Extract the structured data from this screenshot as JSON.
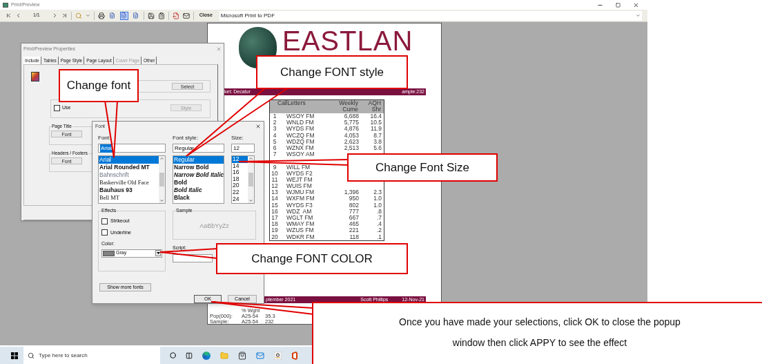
{
  "window": {
    "title": "Print/Preview"
  },
  "toolbar": {
    "page": "1/1",
    "view_modes": [
      {
        "selected": false
      },
      {
        "selected": true
      },
      {
        "selected": false
      }
    ],
    "close": "Close",
    "printer": "Microsoft Print to PDF"
  },
  "report": {
    "logo_text": "EASTLAN",
    "header_left": "ket: Decatur",
    "header_right": "ample:232",
    "columns": [
      "CallLetters",
      "Weekly Cume",
      "AQH Shr"
    ],
    "rows": [
      {
        "rank": "1",
        "call": "WSOY FM",
        "cume": "6,688",
        "shr": "16.4"
      },
      {
        "rank": "2",
        "call": "WNLD FM",
        "cume": "5,775",
        "shr": "10.5"
      },
      {
        "rank": "3",
        "call": "WYDS FM",
        "cume": "4,876",
        "shr": "11.9"
      },
      {
        "rank": "4",
        "call": "WCZQ FM",
        "cume": "4,053",
        "shr": "8.7"
      },
      {
        "rank": "5",
        "call": "WDZQ FM",
        "cume": "2,623",
        "shr": "3.8"
      },
      {
        "rank": "6",
        "call": "WZNX FM",
        "cume": "2,513",
        "shr": "5.6"
      },
      {
        "rank": "7",
        "call": "WSOY AM"
      },
      {
        "rank": "9",
        "call": "WILL FM"
      },
      {
        "rank": "10",
        "call": "WYDS F2"
      },
      {
        "rank": "11",
        "call": "WEJT FM"
      },
      {
        "rank": "12",
        "call": "WUIS FM"
      },
      {
        "rank": "13",
        "call": "WJMU FM",
        "cume": "1,396",
        "shr": "2.3"
      },
      {
        "rank": "14",
        "call": "WXFM FM",
        "cume": "950",
        "shr": "1.0"
      },
      {
        "rank": "15",
        "call": "WYDS F3",
        "cume": "802",
        "shr": "1.0"
      },
      {
        "rank": "16",
        "call": "WDZ  AM",
        "cume": "777",
        "shr": ".8"
      },
      {
        "rank": "17",
        "call": "WGLT FM",
        "cume": "667",
        "shr": ".7"
      },
      {
        "rank": "18",
        "call": "WMAY FM",
        "cume": "465",
        "shr": ".4"
      },
      {
        "rank": "19",
        "call": "WZUS FM",
        "cume": "221",
        "shr": ".2"
      },
      {
        "rank": "20",
        "call": "WDKR FM",
        "cume": "118",
        "shr": ".1"
      }
    ],
    "footer": {
      "left": "ptember 2021",
      "author": "Scott Phillips",
      "date": "12-Nov-21"
    },
    "notes": [
      {
        "label": "Pop(000):",
        "demo": "A25-54",
        "value": "35.3"
      },
      {
        "label": "Sample:",
        "demo": "A25-54",
        "value": "232"
      }
    ],
    "notes_heading": "% Wght"
  },
  "properties_dialog": {
    "title": "Print/Preview Properties",
    "tabs": [
      {
        "label": "Include",
        "selected": true,
        "disabled": false
      },
      {
        "label": "Tables",
        "selected": false,
        "disabled": false
      },
      {
        "label": "Page Style",
        "selected": false,
        "disabled": false
      },
      {
        "label": "Page Layout",
        "selected": false,
        "disabled": false
      },
      {
        "label": "Cover Page",
        "selected": false,
        "disabled": true
      },
      {
        "label": "Other",
        "selected": false,
        "disabled": false
      }
    ],
    "select_button": "Select",
    "page_border": {
      "use_label": "Use",
      "use_checked": false,
      "style_button": "Style",
      "style_disabled": true
    },
    "groups": [
      {
        "label": "Page Title",
        "button": "Font"
      },
      {
        "label": "Headers / Footers",
        "button": "Font"
      }
    ]
  },
  "font_dialog": {
    "title": "Font",
    "font": {
      "label": "Font:",
      "value": "Arial",
      "items": [
        {
          "text": "Arial",
          "kind": "plain",
          "selected": true
        },
        {
          "text": "Arial Rounded MT",
          "kind": "bold",
          "selected": false
        },
        {
          "text": "Bahnschrift",
          "kind": "light",
          "selected": false
        },
        {
          "text": "Baskerville Old Face",
          "kind": "serif",
          "selected": false
        },
        {
          "text": "Bauhaus 93",
          "kind": "heavy",
          "selected": false
        },
        {
          "text": "Bell MT",
          "kind": "serif",
          "selected": false
        }
      ]
    },
    "style": {
      "label": "Font style:",
      "value": "Regular",
      "items": [
        {
          "text": "Regular",
          "kind": "plain",
          "selected": true
        },
        {
          "text": "Narrow Bold",
          "kind": "bold",
          "selected": false
        },
        {
          "text": "Narrow Bold Italic",
          "kind": "bold-italic",
          "selected": false
        },
        {
          "text": "Bold",
          "kind": "bold",
          "selected": false
        },
        {
          "text": "Bold Italic",
          "kind": "bold-italic",
          "selected": false
        },
        {
          "text": "Black",
          "kind": "heavy",
          "selected": false
        }
      ]
    },
    "size": {
      "label": "Size:",
      "value": "12",
      "items": [
        {
          "text": "12",
          "selected": true
        },
        {
          "text": "14",
          "selected": false
        },
        {
          "text": "16",
          "selected": false
        },
        {
          "text": "18",
          "selected": false
        },
        {
          "text": "20",
          "selected": false
        },
        {
          "text": "22",
          "selected": false
        },
        {
          "text": "24",
          "selected": false
        }
      ]
    },
    "effects": {
      "label": "Effects",
      "options": [
        {
          "label": "Strikeout",
          "checked": false
        },
        {
          "label": "Underline",
          "checked": false
        }
      ],
      "color_label": "Color:",
      "color_name": "Gray",
      "color": "#808080"
    },
    "sample": {
      "label": "Sample",
      "text": "AaBbYyZz"
    },
    "script_label": "Script:",
    "more_button": "Show more fonts",
    "ok": "OK",
    "cancel": "Cancel"
  },
  "callouts": [
    {
      "text": "Change font"
    },
    {
      "text": "Change FONT style"
    },
    {
      "text": "Change Font Size"
    },
    {
      "text": "Change FONT COLOR"
    },
    {
      "text": "Once you have made your selections, click OK to close the popup window then click APPY to see the effect"
    }
  ],
  "taskbar": {
    "search_placeholder": "Type here to search"
  }
}
